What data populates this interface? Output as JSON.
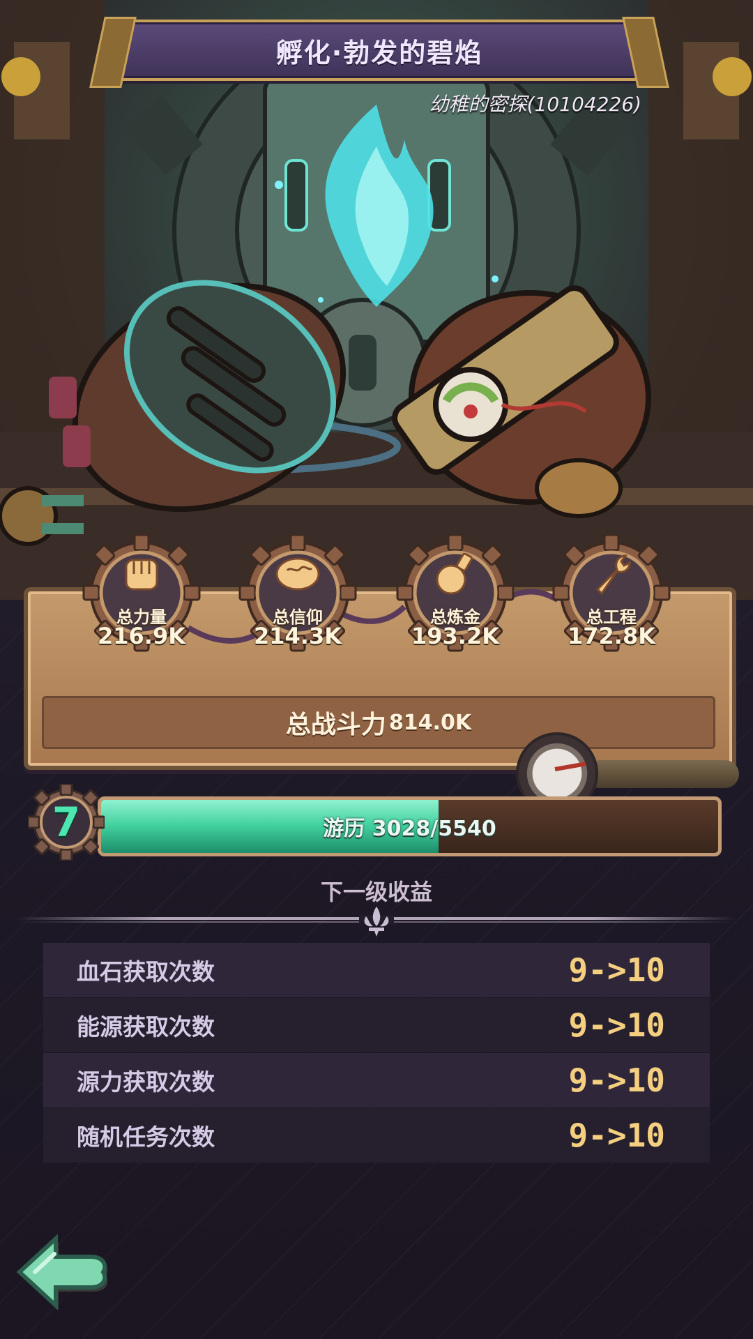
{
  "header": {
    "title": "孵化·勃发的碧焰",
    "subtitle": "幼稚的密探(10104226)"
  },
  "stats": [
    {
      "label": "总力量",
      "value": "216.9K",
      "icon": "fist-icon"
    },
    {
      "label": "总信仰",
      "value": "214.3K",
      "icon": "brain-icon"
    },
    {
      "label": "总炼金",
      "value": "193.2K",
      "icon": "potion-icon"
    },
    {
      "label": "总工程",
      "value": "172.8K",
      "icon": "wrench-icon"
    }
  ],
  "power": {
    "label": "总战斗力",
    "value": "814.0K"
  },
  "level": {
    "number": "7",
    "progress_text": "游历 3028/5540",
    "current": 3028,
    "max": 5540
  },
  "next_level": {
    "title": "下一级收益",
    "rows": [
      {
        "label": "血石获取次数",
        "value": "9->10"
      },
      {
        "label": "能源获取次数",
        "value": "9->10"
      },
      {
        "label": "源力获取次数",
        "value": "9->10"
      },
      {
        "label": "随机任务次数",
        "value": "9->10"
      }
    ]
  },
  "colors": {
    "accent_green": "#4ee6b0",
    "value_gold": "#f5cf80",
    "panel_tan": "#c49a6c"
  },
  "back_button": {
    "icon": "back-arrow-icon"
  }
}
